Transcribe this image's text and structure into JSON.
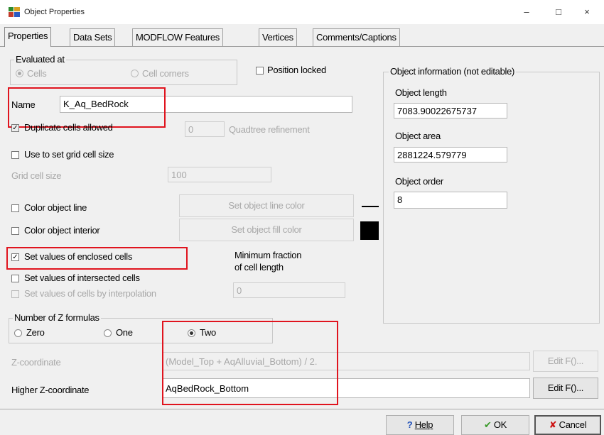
{
  "window": {
    "title": "Object Properties",
    "minimize": "–",
    "maximize": "□",
    "close": "×"
  },
  "tabs": [
    "Properties",
    "Data Sets",
    "MODFLOW Features",
    "Vertices",
    "Comments/Captions"
  ],
  "evaluated": {
    "legend": "Evaluated at",
    "cells": "Cells",
    "cell_corners": "Cell corners"
  },
  "position_locked": "Position locked",
  "name": {
    "label": "Name",
    "value": "K_Aq_BedRock"
  },
  "duplicate_cells": "Duplicate cells allowed",
  "quadtree": {
    "value": "0",
    "label": "Quadtree refinement"
  },
  "grid_cell": {
    "checkbox": "Use to set grid cell size",
    "label": "Grid cell size",
    "value": "100"
  },
  "color_line": {
    "checkbox": "Color object line",
    "button": "Set object line color"
  },
  "color_interior": {
    "checkbox": "Color object interior",
    "button": "Set object fill color"
  },
  "set_values": {
    "enclosed": "Set values of enclosed cells",
    "intersected": "Set values of intersected cells",
    "interpolation": "Set values of cells by interpolation"
  },
  "min_fraction": {
    "line1": "Minimum fraction",
    "line2": "of cell length",
    "value": "0"
  },
  "z_formulas": {
    "legend": "Number of Z formulas",
    "zero": "Zero",
    "one": "One",
    "two": "Two"
  },
  "z_coordinate": {
    "label": "Z-coordinate",
    "value": "(Model_Top + AqAlluvial_Bottom) / 2.",
    "button": "Edit F()..."
  },
  "higher_z": {
    "label": "Higher Z-coordinate",
    "value": "AqBedRock_Bottom",
    "button": "Edit F()..."
  },
  "object_info": {
    "legend": "Object information (not editable)",
    "length_label": "Object length",
    "length_value": "7083.90022675737",
    "area_label": "Object area",
    "area_value": "2881224.579779",
    "order_label": "Object order",
    "order_value": "8"
  },
  "footer": {
    "help": "Help",
    "ok": "OK",
    "cancel": "Cancel"
  },
  "colors": {
    "highlight": "#e0141e",
    "accent_green": "#3a9a2a",
    "cancel_red": "#cc1111"
  }
}
